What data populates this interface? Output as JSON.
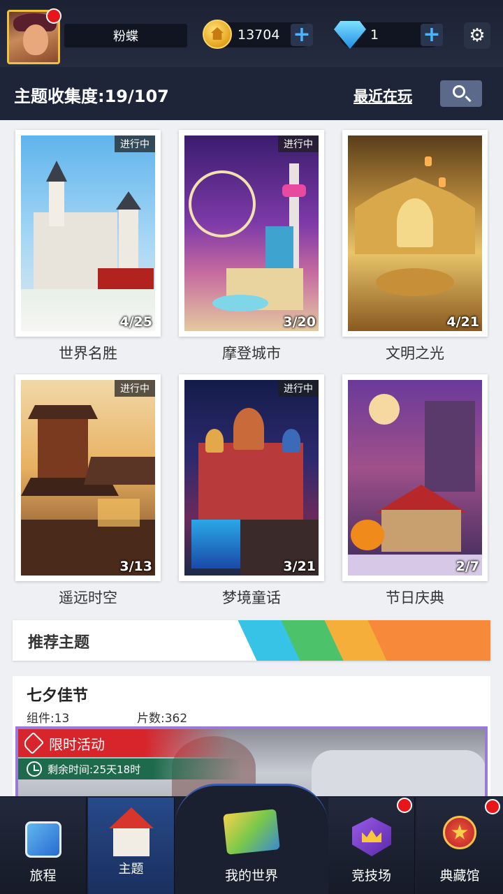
{
  "user": {
    "name": "粉蝶"
  },
  "currency": {
    "coins": "13704",
    "gems": "1"
  },
  "header": {
    "collection_label": "主题收集度:19/107",
    "recent_label": "最近在玩"
  },
  "themes": [
    {
      "title": "世界名胜",
      "count": "4/25",
      "badge": "进行中"
    },
    {
      "title": "摩登城市",
      "count": "3/20",
      "badge": "进行中"
    },
    {
      "title": "文明之光",
      "count": "4/21",
      "badge": ""
    },
    {
      "title": "遥远时空",
      "count": "3/13",
      "badge": "进行中"
    },
    {
      "title": "梦境童话",
      "count": "3/21",
      "badge": "进行中"
    },
    {
      "title": "节日庆典",
      "count": "2/7",
      "badge": ""
    }
  ],
  "recommended": {
    "section_title": "推荐主题",
    "name": "七夕佳节",
    "parts": "组件:13",
    "pieces": "片数:362",
    "limited_label": "限时活动",
    "remaining": "剩余时间:25天18时"
  },
  "nav": [
    {
      "label": "旅程"
    },
    {
      "label": "主题"
    },
    {
      "label": "我的世界"
    },
    {
      "label": "竞技场"
    },
    {
      "label": "典藏馆"
    }
  ],
  "colors": {
    "topbar": "#1c2233",
    "accent_blue": "#4db3ff",
    "notify_red": "#e8161b",
    "nav_active": "#274a8a"
  }
}
